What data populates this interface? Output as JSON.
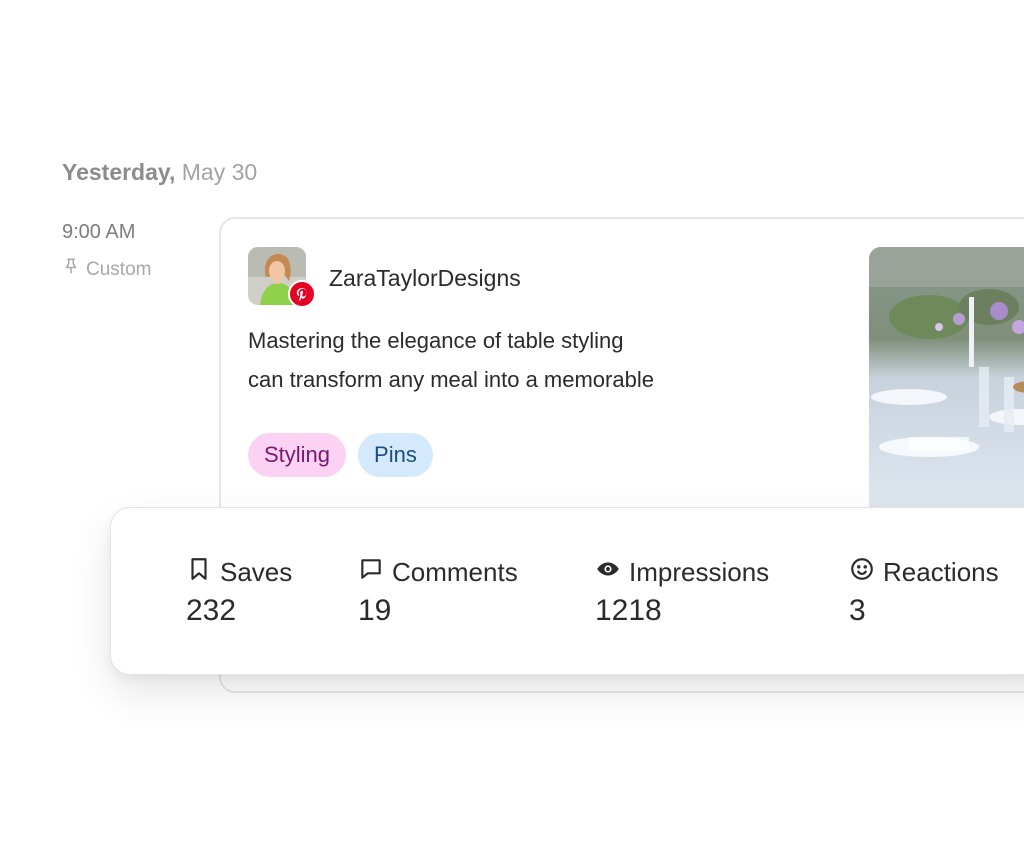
{
  "schedule": {
    "day_label": "Yesterday,",
    "date_label": "May 30",
    "time": "9:00 AM",
    "slot_type": "Custom"
  },
  "post": {
    "account_name": "ZaraTaylorDesigns",
    "network": "pinterest",
    "text_line1": "Mastering the elegance of table styling",
    "text_line2": "can transform any meal into a memorable",
    "tags": [
      {
        "label": "Styling",
        "color": "#fbd2f4"
      },
      {
        "label": "Pins",
        "color": "#d4e9fb"
      }
    ]
  },
  "metrics": [
    {
      "icon": "bookmark-icon",
      "label": "Saves",
      "value": "232"
    },
    {
      "icon": "comment-icon",
      "label": "Comments",
      "value": "19"
    },
    {
      "icon": "eye-icon",
      "label": "Impressions",
      "value": "1218"
    },
    {
      "icon": "smiley-icon",
      "label": "Reactions",
      "value": "3"
    }
  ],
  "colors": {
    "pinterest_red": "#e60023",
    "text_primary": "#2b2b2b",
    "text_muted": "#9a9a9a"
  }
}
